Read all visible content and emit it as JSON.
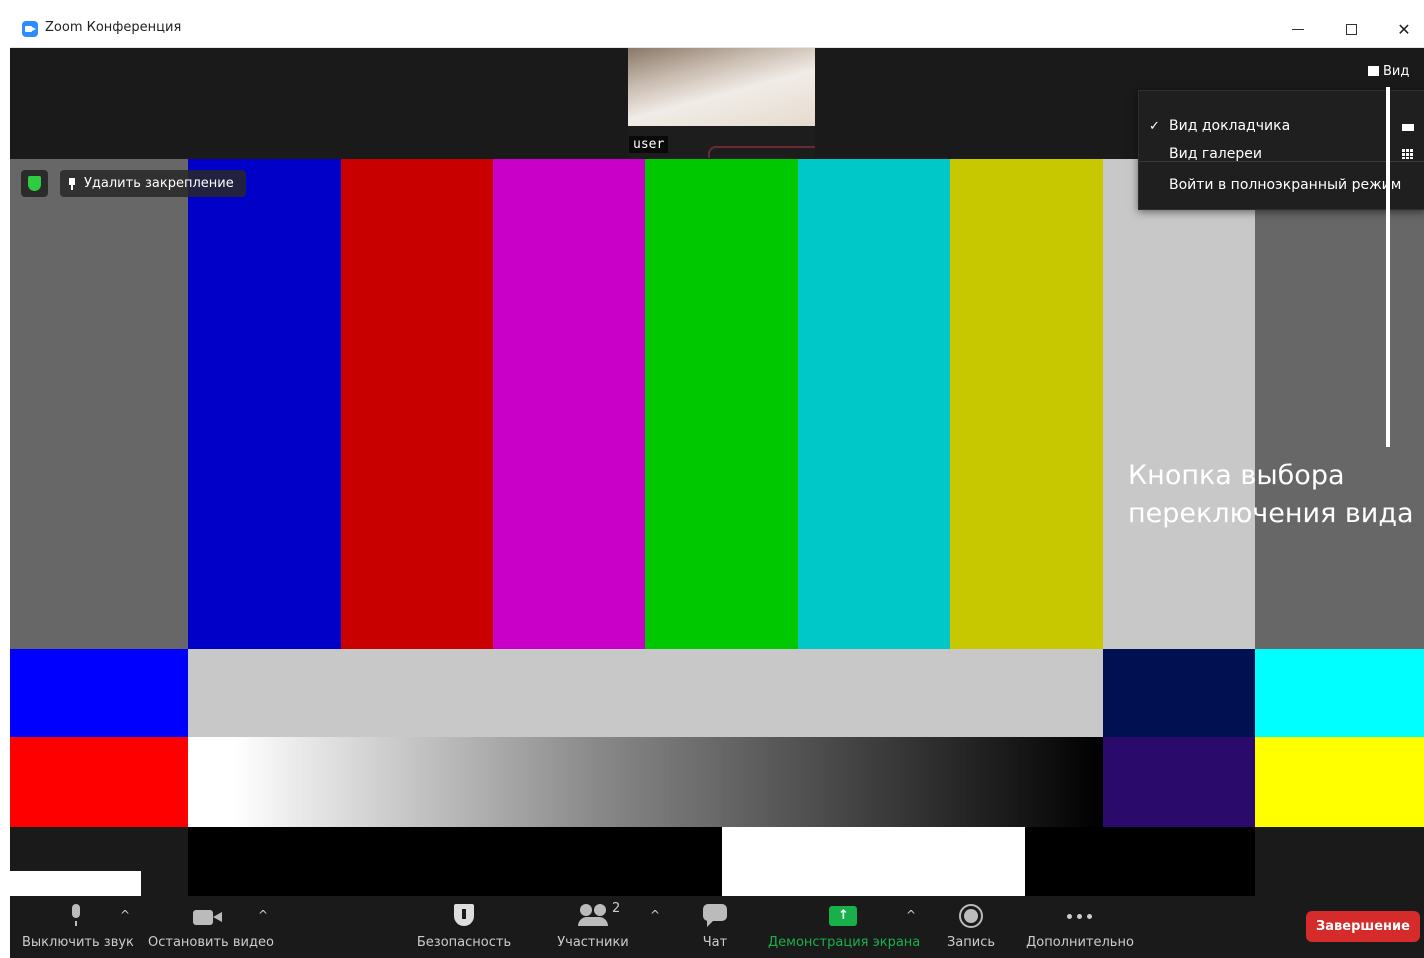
{
  "window": {
    "title": "Zoom Конференция"
  },
  "thumbnail": {
    "name": "user"
  },
  "view_button": {
    "label": "Вид"
  },
  "security_badge": {
    "color": "#2ecc40"
  },
  "pin_chip": {
    "label": "Удалить закрепление"
  },
  "view_menu": {
    "items": [
      {
        "label": "Вид докладчика",
        "checked": true,
        "icon": "speaker-view-icon"
      },
      {
        "label": "Вид галереи",
        "checked": false,
        "icon": "gallery-view-icon"
      },
      {
        "label": "Войти в полноэкранный режим",
        "checked": false
      }
    ]
  },
  "annotation": {
    "text": "Кнопка выбора переключения вида"
  },
  "color_bars": {
    "top_row": [
      "#676767",
      "#0000c8",
      "#c80000",
      "#c800c8",
      "#00c800",
      "#00c8c8",
      "#c8c800",
      "#c8c8c8",
      "#676767"
    ],
    "second_row": [
      "#0000ff",
      "#c8c8c8",
      "#001050",
      "#00ffff"
    ],
    "third_row": [
      "#ff0000",
      "gradient-white-to-black",
      "#2a0a6a",
      "#ffff00"
    ],
    "bottom_row": [
      "#1a1a1a",
      "#000000",
      "#ffffff",
      "#000000",
      "#1a1a1a"
    ]
  },
  "toolbar": {
    "mute": "Выключить звук",
    "stop_video": "Остановить видео",
    "security": "Безопасность",
    "participants": "Участники",
    "participants_count": "2",
    "chat": "Чат",
    "share": "Демонстрация экрана",
    "record": "Запись",
    "more": "Дополнительно",
    "end": "Завершение"
  },
  "colors": {
    "share_green": "#18b04a",
    "end_red": "#d62b2b",
    "accent": "#2d8cff"
  }
}
